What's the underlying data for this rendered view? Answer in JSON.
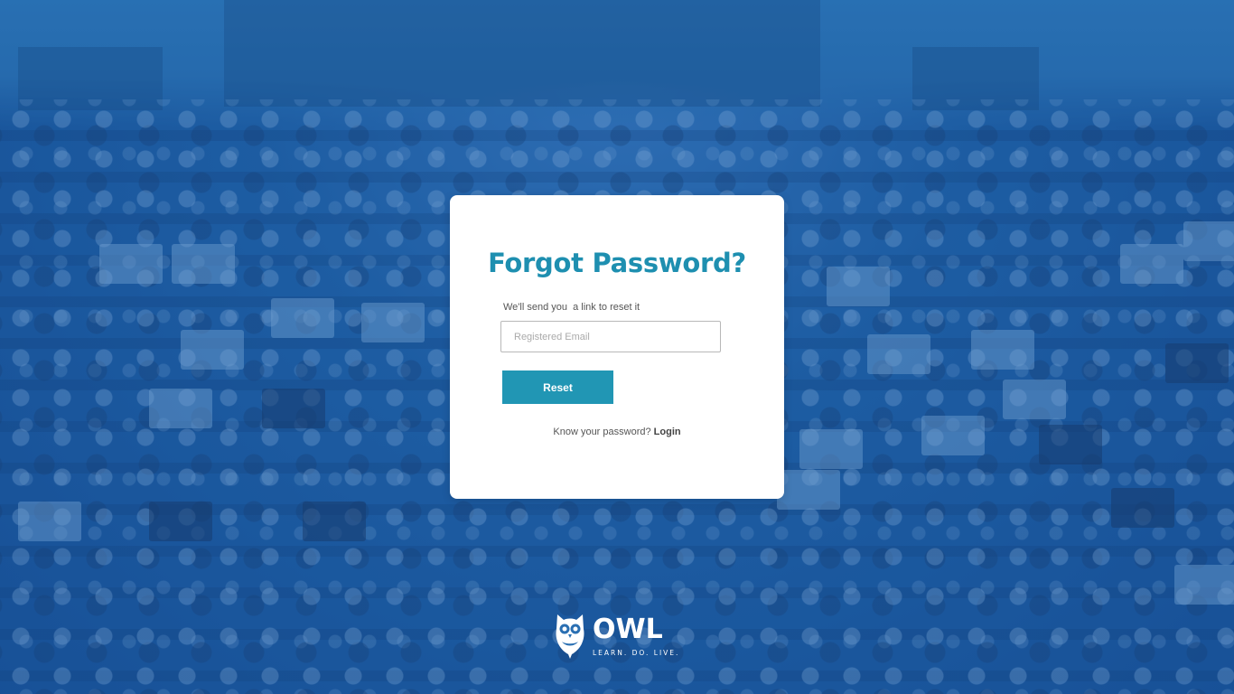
{
  "colors": {
    "accent": "#2196b4",
    "title": "#1e8fb0",
    "overlay": "#1f5f9e"
  },
  "background": {
    "description_icon": "lecture-hall-photo"
  },
  "form": {
    "title": "Forgot Password?",
    "subtitle": "We'll send you  a link to reset it",
    "email_placeholder": "Registered Email",
    "email_value": "",
    "reset_label": "Reset",
    "login_prompt": "Know your password?",
    "login_link": "Login"
  },
  "logo": {
    "icon": "owl-icon",
    "wordmark": "OWL",
    "tagline": "LEARN. DO. LIVE."
  }
}
